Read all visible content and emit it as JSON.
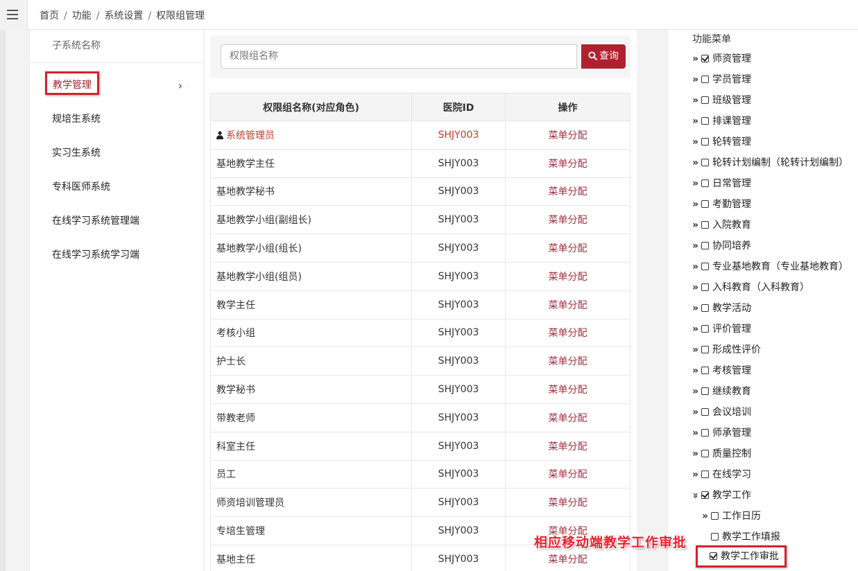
{
  "breadcrumb": [
    "首页",
    "功能",
    "系统设置",
    "权限组管理"
  ],
  "subsystems": {
    "header": "子系统名称",
    "items": [
      {
        "label": "教学管理",
        "active": true
      },
      {
        "label": "规培生系统"
      },
      {
        "label": "实习生系统"
      },
      {
        "label": "专科医师系统"
      },
      {
        "label": "在线学习系统管理端"
      },
      {
        "label": "在线学习系统学习端"
      }
    ]
  },
  "search": {
    "placeholder": "权限组名称",
    "button_label": "查询"
  },
  "table": {
    "headers": [
      "权限组名称(对应角色)",
      "医院ID",
      "操作"
    ],
    "rows": [
      {
        "name": "系统管理员",
        "id": "SHJY003",
        "action": "菜单分配"
      },
      {
        "name": "基地教学主任",
        "id": "SHJY003",
        "action": "菜单分配"
      },
      {
        "name": "基地教学秘书",
        "id": "SHJY003",
        "action": "菜单分配"
      },
      {
        "name": "基地教学小组(副组长)",
        "id": "SHJY003",
        "action": "菜单分配"
      },
      {
        "name": "基地教学小组(组长)",
        "id": "SHJY003",
        "action": "菜单分配"
      },
      {
        "name": "基地教学小组(组员)",
        "id": "SHJY003",
        "action": "菜单分配"
      },
      {
        "name": "教学主任",
        "id": "SHJY003",
        "action": "菜单分配"
      },
      {
        "name": "考核小组",
        "id": "SHJY003",
        "action": "菜单分配"
      },
      {
        "name": "护士长",
        "id": "SHJY003",
        "action": "菜单分配"
      },
      {
        "name": "教学秘书",
        "id": "SHJY003",
        "action": "菜单分配"
      },
      {
        "name": "带教老师",
        "id": "SHJY003",
        "action": "菜单分配"
      },
      {
        "name": "科室主任",
        "id": "SHJY003",
        "action": "菜单分配"
      },
      {
        "name": "员工",
        "id": "SHJY003",
        "action": "菜单分配"
      },
      {
        "name": "师资培训管理员",
        "id": "SHJY003",
        "action": "菜单分配"
      },
      {
        "name": "专培生管理",
        "id": "SHJY003",
        "action": "菜单分配"
      },
      {
        "name": "基地主任",
        "id": "SHJY003",
        "action": "菜单分配"
      }
    ]
  },
  "menu": {
    "title": "功能菜单",
    "items": [
      {
        "label": "师资管理",
        "checked": true,
        "arrow": "»"
      },
      {
        "label": "学员管理",
        "checked": false,
        "arrow": "»"
      },
      {
        "label": "班级管理",
        "checked": false,
        "arrow": "»"
      },
      {
        "label": "排课管理",
        "checked": false,
        "arrow": "»"
      },
      {
        "label": "轮转管理",
        "checked": false,
        "arrow": "»"
      },
      {
        "label": "轮转计划编制（轮转计划编制）",
        "checked": false,
        "arrow": "»"
      },
      {
        "label": "日常管理",
        "checked": false,
        "arrow": "»"
      },
      {
        "label": "考勤管理",
        "checked": false,
        "arrow": "»"
      },
      {
        "label": "入院教育",
        "checked": false,
        "arrow": "»"
      },
      {
        "label": "协同培养",
        "checked": false,
        "arrow": "»"
      },
      {
        "label": "专业基地教育（专业基地教育）",
        "checked": false,
        "arrow": "»"
      },
      {
        "label": "入科教育（入科教育）",
        "checked": false,
        "arrow": "»"
      },
      {
        "label": "教学活动",
        "checked": false,
        "arrow": "»"
      },
      {
        "label": "评价管理",
        "checked": false,
        "arrow": "»"
      },
      {
        "label": "形成性评价",
        "checked": false,
        "arrow": "»"
      },
      {
        "label": "考核管理",
        "checked": false,
        "arrow": "»"
      },
      {
        "label": "继续教育",
        "checked": false,
        "arrow": "»"
      },
      {
        "label": "会议培训",
        "checked": false,
        "arrow": "»"
      },
      {
        "label": "师承管理",
        "checked": false,
        "arrow": "»"
      },
      {
        "label": "质量控制",
        "checked": false,
        "arrow": "»"
      },
      {
        "label": "在线学习",
        "checked": false,
        "arrow": "»"
      },
      {
        "label": "教学工作",
        "checked": true,
        "arrow": "»",
        "expanded": true
      },
      {
        "label": "工作日历",
        "checked": false,
        "arrow": "»",
        "level": 1
      },
      {
        "label": "教学工作填报",
        "checked": false,
        "arrow": "",
        "level": 1
      },
      {
        "label": "教学工作审批",
        "checked": true,
        "arrow": "",
        "level": 1,
        "highlight": true
      }
    ]
  },
  "annotation": "相应移动端教学工作审批",
  "colors": {
    "accent": "#b0202e",
    "highlight_border": "#d6212e",
    "link": "#a03040"
  }
}
